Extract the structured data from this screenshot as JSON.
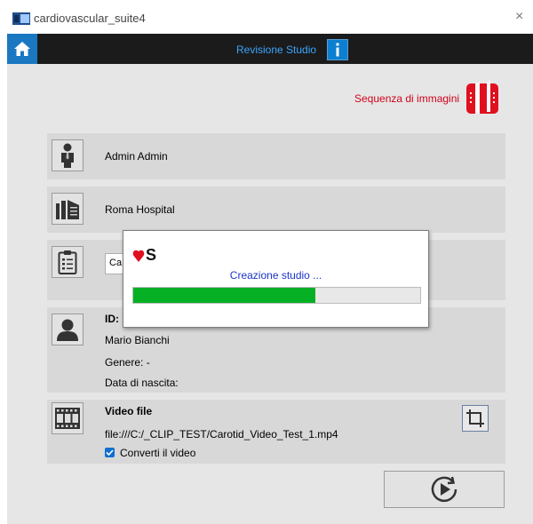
{
  "window": {
    "title": "cardiovascular_suite4",
    "close_glyph": "×"
  },
  "header": {
    "title": "Revisione Studio",
    "info_icon": "info-icon",
    "home_icon": "home-icon"
  },
  "sequence": {
    "label": "Sequenza di immagini",
    "icon": "image-sequence-icon"
  },
  "operator": {
    "name": "Admin  Admin",
    "icon": "operator-icon"
  },
  "hospital": {
    "name": "Roma Hospital",
    "icon": "hospital-icon"
  },
  "study": {
    "value": "Ca",
    "icon": "clipboard-icon"
  },
  "patient": {
    "id_label": "ID:",
    "name": "Mario  Bianchi",
    "gender": "Genere: -",
    "birth": "Data di nascita:",
    "icon": "patient-icon"
  },
  "video": {
    "title": "Video file",
    "path": "file:///C:/_CLIP_TEST/Carotid_Video_Test_1.mp4",
    "convert_label": "Converti il video",
    "convert_checked": true,
    "icon": "film-icon"
  },
  "dialog": {
    "status": "Creazione studio ...",
    "progress": 0.635,
    "logo_text": "S"
  },
  "colors": {
    "accent_blue": "#1a78c2",
    "header_bg": "#1b1b1b",
    "brand_red": "#d0021b",
    "progress_green": "#06b025"
  }
}
